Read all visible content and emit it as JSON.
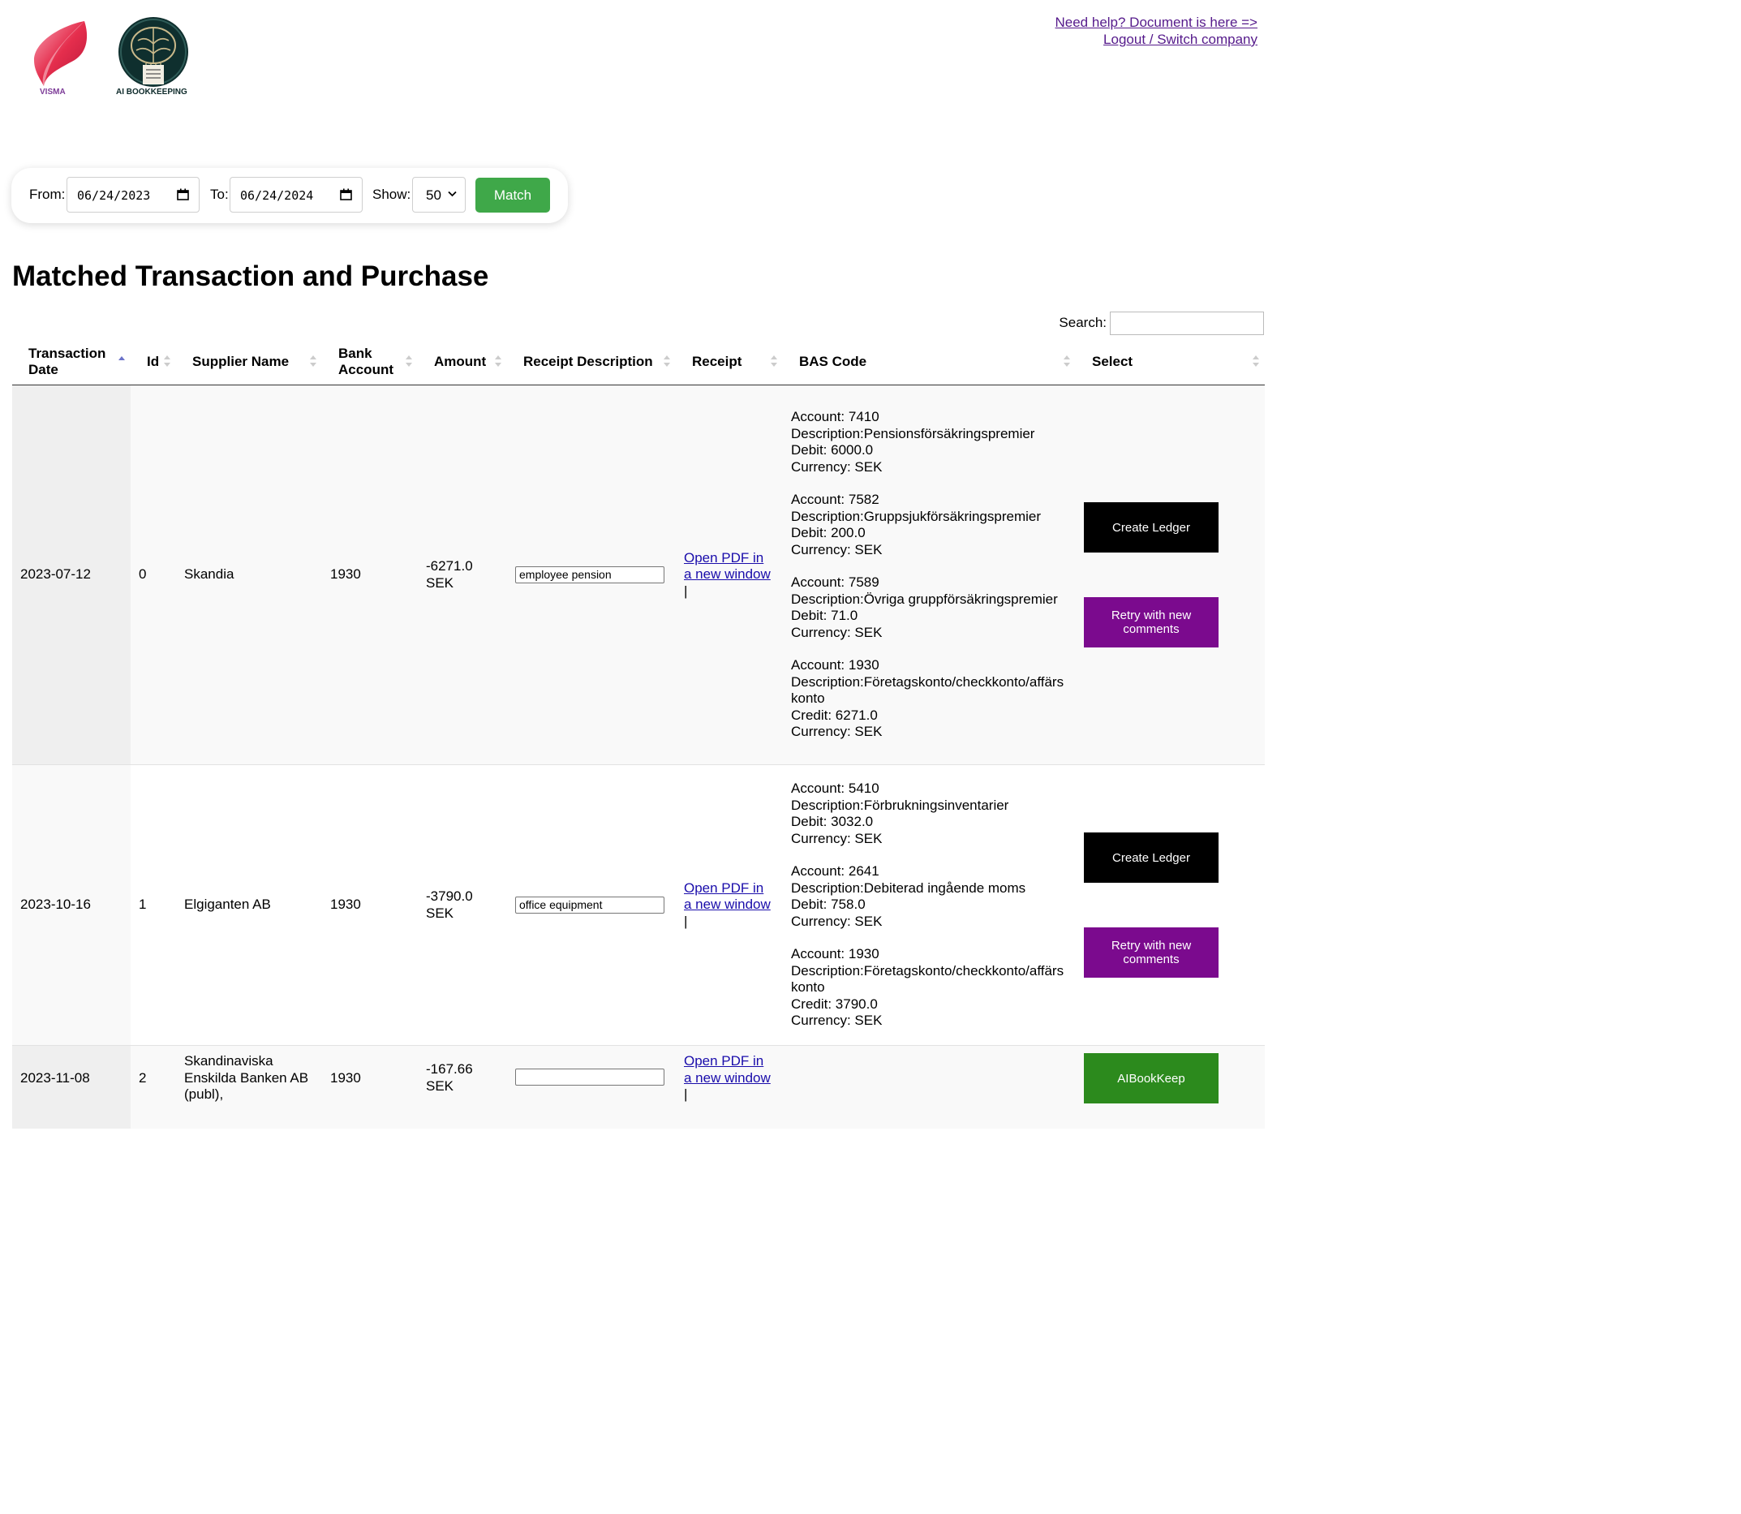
{
  "header": {
    "logo_visma_text": "VISMA",
    "logo_ai_text": "AI BOOKKEEPING",
    "help_link": "Need help? Document is here =>",
    "logout_link": "Logout / Switch company"
  },
  "filter": {
    "from_label": "From:",
    "from_value": "06/24/2023",
    "to_label": "To:",
    "to_value": "06/24/2024",
    "show_label": "Show:",
    "show_value": "50",
    "match_label": "Match"
  },
  "page_title": "Matched Transaction and Purchase",
  "search_label": "Search:",
  "table": {
    "headers": [
      "Transaction Date",
      "Id",
      "Supplier Name",
      "Bank Account",
      "Amount",
      "Receipt Description",
      "Receipt",
      "BAS Code",
      "Select"
    ],
    "rows": [
      {
        "date": "2023-07-12",
        "id": "0",
        "supplier": "Skandia",
        "bank": "1930",
        "amount": "-6271.0",
        "currency": "SEK",
        "description": "employee pension",
        "pdf_link": "Open PDF in a new window",
        "pdf_sep": "|",
        "bas": [
          [
            "Account: 7410",
            "Description:Pensionsförsäkringspremier",
            "Debit: 6000.0",
            "Currency: SEK"
          ],
          [
            "Account: 7582",
            "Description:Gruppsjukförsäkringspremier",
            "Debit: 200.0",
            "Currency: SEK"
          ],
          [
            "Account: 7589",
            "Description:Övriga gruppförsäkringspremier",
            "Debit: 71.0",
            "Currency: SEK"
          ],
          [
            "Account: 1930",
            "Description:Företagskonto/checkkonto/affärskonto",
            "Credit: 6271.0",
            "Currency: SEK"
          ]
        ],
        "btn_primary": "Create Ledger",
        "btn_secondary": "Retry with new comments"
      },
      {
        "date": "2023-10-16",
        "id": "1",
        "supplier": "Elgiganten AB",
        "bank": "1930",
        "amount": "-3790.0",
        "currency": "SEK",
        "description": "office equipment",
        "pdf_link": "Open PDF in a new window",
        "pdf_sep": "|",
        "bas": [
          [
            "Account: 5410",
            "Description:Förbrukningsinventarier",
            "Debit: 3032.0",
            "Currency: SEK"
          ],
          [
            "Account: 2641",
            "Description:Debiterad ingående moms",
            "Debit: 758.0",
            "Currency: SEK"
          ],
          [
            "Account: 1930",
            "Description:Företagskonto/checkkonto/affärskonto",
            "Credit: 3790.0",
            "Currency: SEK"
          ]
        ],
        "btn_primary": "Create Ledger",
        "btn_secondary": "Retry with new comments"
      },
      {
        "date": "2023-11-08",
        "id": "2",
        "supplier": "Skandinaviska Enskilda Banken AB (publ),",
        "bank": "1930",
        "amount": "-167.66",
        "currency": "SEK",
        "description": "",
        "pdf_link": "Open PDF in a new window",
        "pdf_sep": "|",
        "btn_primary": "AIBookKeep"
      }
    ]
  },
  "colors": {
    "match_green": "#3fa849",
    "create_black": "#000000",
    "retry_purple": "#7b0a8e",
    "aibookkeep_green": "#2c8a1d",
    "link_blue": "#1a0dab",
    "visited_purple": "#551a8b"
  }
}
